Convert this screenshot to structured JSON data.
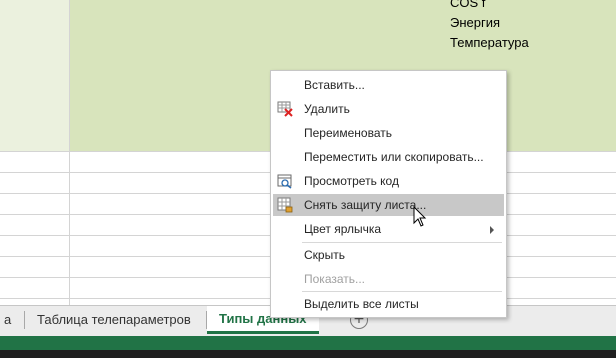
{
  "sheet": {
    "cell_lines": [
      "COS f",
      "Энергия",
      "Температура"
    ]
  },
  "context_menu": {
    "items": [
      {
        "label": "Вставить...",
        "underline": "ь",
        "icon": "",
        "state": "normal"
      },
      {
        "label": "Удалить",
        "underline": "У",
        "icon": "delete-sheet-icon",
        "state": "normal"
      },
      {
        "label": "Переименовать",
        "underline": "и",
        "icon": "",
        "state": "normal"
      },
      {
        "label": "Переместить или скопировать...",
        "underline": "П",
        "icon": "",
        "state": "normal"
      },
      {
        "label": "Просмотреть код",
        "underline": "р",
        "icon": "view-code-icon",
        "state": "normal"
      },
      {
        "label": "Снять защиту листа...",
        "underline": "л",
        "icon": "unprotect-sheet-icon",
        "state": "hover"
      },
      {
        "label": "Цвет ярлычка",
        "underline": "Ц",
        "icon": "",
        "state": "normal",
        "submenu": true
      },
      {
        "label": "Скрыть",
        "underline": "к",
        "icon": "",
        "state": "normal"
      },
      {
        "label": "Показать...",
        "underline": "о",
        "icon": "",
        "state": "disabled"
      },
      {
        "label": "Выделить все листы",
        "underline": "В",
        "icon": "",
        "state": "normal"
      }
    ]
  },
  "tabs": {
    "items": [
      {
        "label": "а",
        "active": false
      },
      {
        "label": "Таблица телепараметров",
        "active": false
      },
      {
        "label": "Типы данных",
        "active": true
      }
    ],
    "add_label": "+"
  },
  "colors": {
    "accent": "#217346",
    "menu_hover": "#c8c8c8",
    "cell_fill": "#d8e4bc",
    "cell_fill_light": "#ebf1de"
  }
}
